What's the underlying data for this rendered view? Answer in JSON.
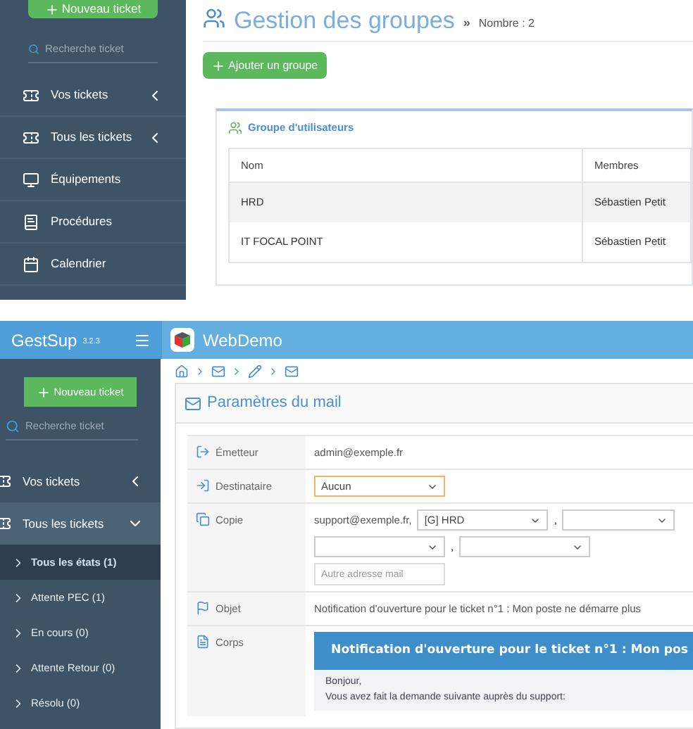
{
  "top": {
    "sidebar": {
      "new_ticket_button": "Nouveau ticket",
      "search_placeholder": "Recherche ticket",
      "items": [
        {
          "label": "Vos tickets",
          "expanded": false
        },
        {
          "label": "Tous les tickets",
          "expanded": false
        },
        {
          "label": "Équipements"
        },
        {
          "label": "Procédures"
        },
        {
          "label": "Calendrier"
        }
      ]
    },
    "page_title": "Gestion des groupes",
    "title_separator": "»",
    "count": "Nombre : 2",
    "add_button": "Ajouter un groupe",
    "panel_tab": "Groupe d'utilisateurs",
    "table": {
      "columns": [
        "Nom",
        "Membres"
      ],
      "rows": [
        [
          "HRD",
          "Sébastien Petit"
        ],
        [
          "IT FOCAL POINT",
          "Sébastien Petit"
        ]
      ]
    }
  },
  "bottom": {
    "sidebar": {
      "app_name": "GestSup",
      "version": "3.2.3",
      "new_ticket_button": "Nouveau ticket",
      "search_placeholder": "Recherche ticket",
      "items": [
        {
          "label": "Vos tickets",
          "expanded": false
        },
        {
          "label": "Tous les tickets",
          "expanded": true,
          "children": [
            {
              "label": "Tous les états (1)",
              "selected": true
            },
            {
              "label": "Attente PEC (1)",
              "selected": false
            },
            {
              "label": "En cours (0)",
              "selected": false
            },
            {
              "label": "Attente Retour (0)",
              "selected": false
            },
            {
              "label": "Résolu (0)",
              "selected": false
            }
          ]
        }
      ]
    },
    "header_title": "WebDemo",
    "panel_title": "Paramètres du mail",
    "form": [
      {
        "kind": "text",
        "label": "Émetteur",
        "value": "admin@exemple.fr"
      },
      {
        "kind": "select",
        "label": "Destinataire",
        "value": "Aucun"
      },
      {
        "kind": "copy",
        "label": "Copie",
        "value": "support@exemple.fr,",
        "selects": [
          {
            "kind": "value",
            "value": "[G] HRD"
          },
          {
            "kind": "empty"
          },
          {
            "kind": "empty"
          },
          {
            "kind": "empty"
          }
        ],
        "separator": ",",
        "placeholder": "Autre adresse mail"
      },
      {
        "kind": "text",
        "label": "Objet",
        "value": "Notification d'ouverture pour le ticket n°1 : Mon poste ne démarre plus"
      },
      {
        "kind": "body",
        "label": "Corps",
        "heading": "Notification d'ouverture pour le ticket n°1 : Mon pos",
        "lines": [
          "Bonjour,",
          "Vous avez fait la demande suivante auprès du support:"
        ]
      }
    ]
  }
}
